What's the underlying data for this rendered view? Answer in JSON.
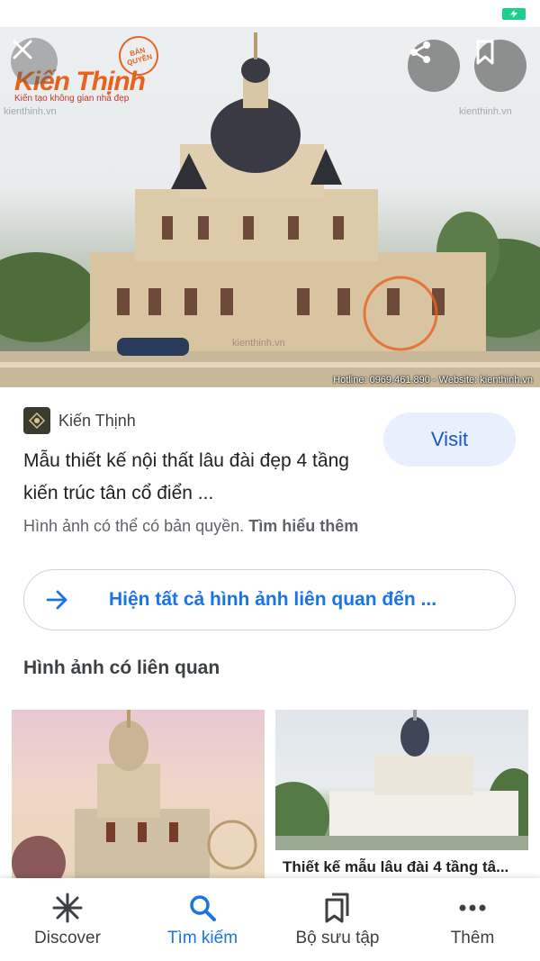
{
  "status_bar": {
    "battery_icon": "battery-charging-icon",
    "battery_color": "#1ccf8a"
  },
  "hero": {
    "brand_logo_text": "Kiến Thịnh",
    "brand_tagline": "Kiến tạo không gian nhà đẹp",
    "stamp_text": "BẢN QUYỀN",
    "watermark": "kienthinh.vn",
    "hotline_text": "Hotline: 0969.461.890 - Website: kienthinh.vn",
    "close_icon": "close-icon",
    "share_icon": "share-icon",
    "bookmark_icon": "bookmark-icon"
  },
  "source": {
    "name": "Kiến Thịnh"
  },
  "result": {
    "title": "Mẫu thiết kế nội thất lâu đài đẹp 4 tầng kiến trúc tân cổ điển ...",
    "visit_label": "Visit",
    "copyright_text": "Hình ảnh có thể có bản quyền.",
    "learn_more": "Tìm hiểu thêm"
  },
  "related_button": {
    "label": "Hiện tất cả hình ảnh liên quan đến ..."
  },
  "related": {
    "section_title": "Hình ảnh có liên quan",
    "cards": [
      {
        "caption": ""
      },
      {
        "caption": "Thiết kế mẫu lâu đài 4 tầng tâ..."
      }
    ]
  },
  "bottom_nav": {
    "items": [
      {
        "label": "Discover",
        "icon": "asterisk-icon"
      },
      {
        "label": "Tìm kiếm",
        "icon": "search-icon"
      },
      {
        "label": "Bộ sưu tập",
        "icon": "collections-icon"
      },
      {
        "label": "Thêm",
        "icon": "more-dots-icon"
      }
    ],
    "active_index": 1,
    "active_color": "#1a73e8"
  },
  "colors": {
    "accent": "#1a73e8",
    "visit_bg": "#e8f0fe",
    "brand_orange": "#e8621e"
  }
}
